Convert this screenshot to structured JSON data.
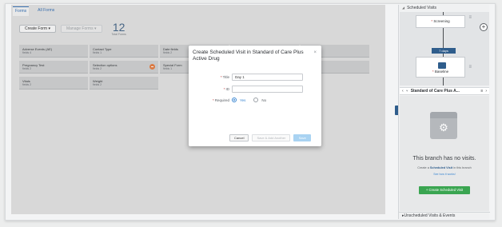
{
  "tabs": [
    {
      "label": "Forms"
    },
    {
      "label": "All Forms"
    }
  ],
  "toolbar": {
    "create_label": "Create Form ▾",
    "manage_label": "Manage Forms ▾",
    "count": "12",
    "count_label": "Total Forms"
  },
  "forms": [
    {
      "name": "Adverse Events (AE)",
      "meta": "fields 4"
    },
    {
      "name": "Contact Type",
      "meta": "fields 1"
    },
    {
      "name": "Date fields",
      "meta": "fields 2"
    },
    {
      "name": "",
      "meta": ""
    },
    {
      "name": "",
      "meta": ""
    },
    {
      "name": "Pregnancy Test",
      "meta": "fields 2"
    },
    {
      "name": "Selection options",
      "meta": "fields 2"
    },
    {
      "name": "Special Form",
      "meta": "fields 1"
    },
    {
      "name": "",
      "meta": ""
    },
    {
      "name": "",
      "meta": ""
    },
    {
      "name": "Vitals",
      "meta": "fields 2"
    },
    {
      "name": "Weight",
      "meta": "fields 2"
    }
  ],
  "modal": {
    "title": "Create Scheduled Visit in Standard of Care Plus Active Drug",
    "close": "×",
    "title_label": "Title",
    "title_value": "Day 1",
    "id_label": "ID",
    "id_value": "",
    "required_label": "Required",
    "yes_label": "Yes",
    "no_label": "No",
    "required_value": "Yes",
    "cancel_label": "Cancel",
    "save_add_label": "Save & Add Another",
    "save_label": "Save"
  },
  "right_panel": {
    "header": "Scheduled Visits",
    "screening_label": "Screening",
    "days_label": "7 days",
    "baseline_label": "Baseline",
    "branch_label": "Standard of Care Plus A...",
    "empty_title": "This branch has no visits.",
    "empty_desc_prefix": "Create a ",
    "empty_desc_link": "Scheduled Visit",
    "empty_desc_suffix": " in this branch",
    "empty_link": "See how it works!",
    "create_button": "Create Scheduled Visit",
    "footer": "Unscheduled Visits & Events"
  },
  "colors": {
    "accent": "#2f5d8c",
    "primary_blue": "#3a86d1",
    "green": "#3aa551",
    "badge": "#e8834a"
  },
  "icons": {
    "close": "close-icon",
    "chevron": "chevron-down-icon",
    "add": "plus-icon",
    "calendar": "calendar-icon",
    "gear": "gear-icon",
    "branch": "branch-icon",
    "menu": "menu-icon"
  }
}
